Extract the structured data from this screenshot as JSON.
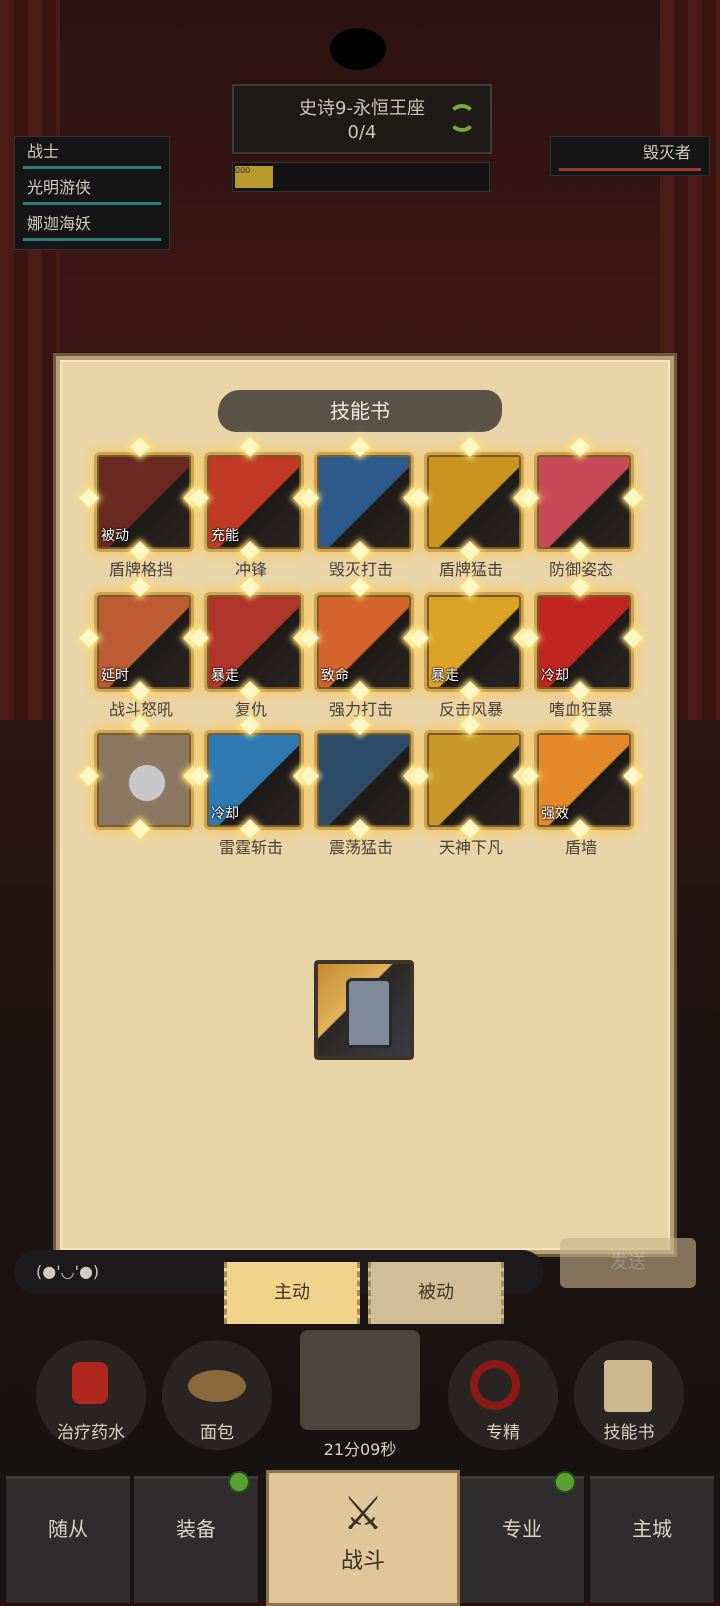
{
  "header": {
    "stage_title": "史诗9-永恒王座",
    "stage_progress": "0/4",
    "progress_label": "000"
  },
  "party": {
    "members": [
      {
        "name": "战士"
      },
      {
        "name": "光明游侠"
      },
      {
        "name": "娜迦海妖"
      }
    ],
    "enemy": "毁灭者"
  },
  "skillbook": {
    "title": "技能书",
    "skills": [
      {
        "name": "盾牌格挡",
        "tag": "被动",
        "color": "#6b2a21"
      },
      {
        "name": "冲锋",
        "tag": "充能",
        "color": "#c23a26"
      },
      {
        "name": "毁灭打击",
        "tag": "",
        "color": "#2d5a8a"
      },
      {
        "name": "盾牌猛击",
        "tag": "",
        "color": "#c9951f"
      },
      {
        "name": "防御姿态",
        "tag": "",
        "color": "#c74b56"
      },
      {
        "name": "战斗怒吼",
        "tag": "延时",
        "color": "#bd5c33"
      },
      {
        "name": "复仇",
        "tag": "暴走",
        "color": "#b0352b"
      },
      {
        "name": "强力打击",
        "tag": "致命",
        "color": "#d4642b"
      },
      {
        "name": "反击风暴",
        "tag": "暴走",
        "color": "#d9a126"
      },
      {
        "name": "嗜血狂暴",
        "tag": "冷却",
        "color": "#c0261f"
      },
      {
        "name": "",
        "tag": "",
        "color": "#8c7860",
        "empty": true
      },
      {
        "name": "雷霆斩击",
        "tag": "冷却",
        "color": "#2f7ab3"
      },
      {
        "name": "震荡猛击",
        "tag": "",
        "color": "#2a4a66"
      },
      {
        "name": "天神下凡",
        "tag": "",
        "color": "#c99a2b"
      },
      {
        "name": "盾墙",
        "tag": "强效",
        "color": "#e6892c"
      }
    ]
  },
  "chat": {
    "emoticon": "(●'◡'●)",
    "send_label": "发送"
  },
  "tabs": {
    "active_label": "主动",
    "passive_label": "被动"
  },
  "items": [
    {
      "label": "治疗药水"
    },
    {
      "label": "面包"
    },
    {
      "label": ""
    },
    {
      "label": "专精"
    },
    {
      "label": "技能书"
    }
  ],
  "timer": "21分09秒",
  "nav": {
    "followers": "随从",
    "equipment": "装备",
    "battle": "战斗",
    "profession": "专业",
    "city": "主城"
  }
}
